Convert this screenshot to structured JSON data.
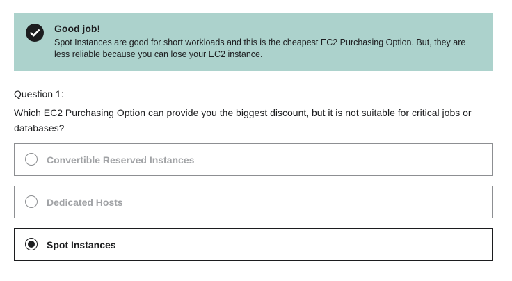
{
  "feedback": {
    "title": "Good job!",
    "message": "Spot Instances are good for short workloads and this is the cheapest EC2 Purchasing Option. But, they are less reliable because you can lose your EC2 instance.",
    "icon": "check-circle-icon",
    "background_color": "#acd2cc"
  },
  "question": {
    "label": "Question 1:",
    "text": "Which EC2 Purchasing Option can provide you the biggest discount, but it is not suitable for critical jobs or databases?"
  },
  "options": [
    {
      "label": "Convertible Reserved Instances",
      "selected": false
    },
    {
      "label": "Dedicated Hosts",
      "selected": false
    },
    {
      "label": "Spot Instances",
      "selected": true
    }
  ]
}
